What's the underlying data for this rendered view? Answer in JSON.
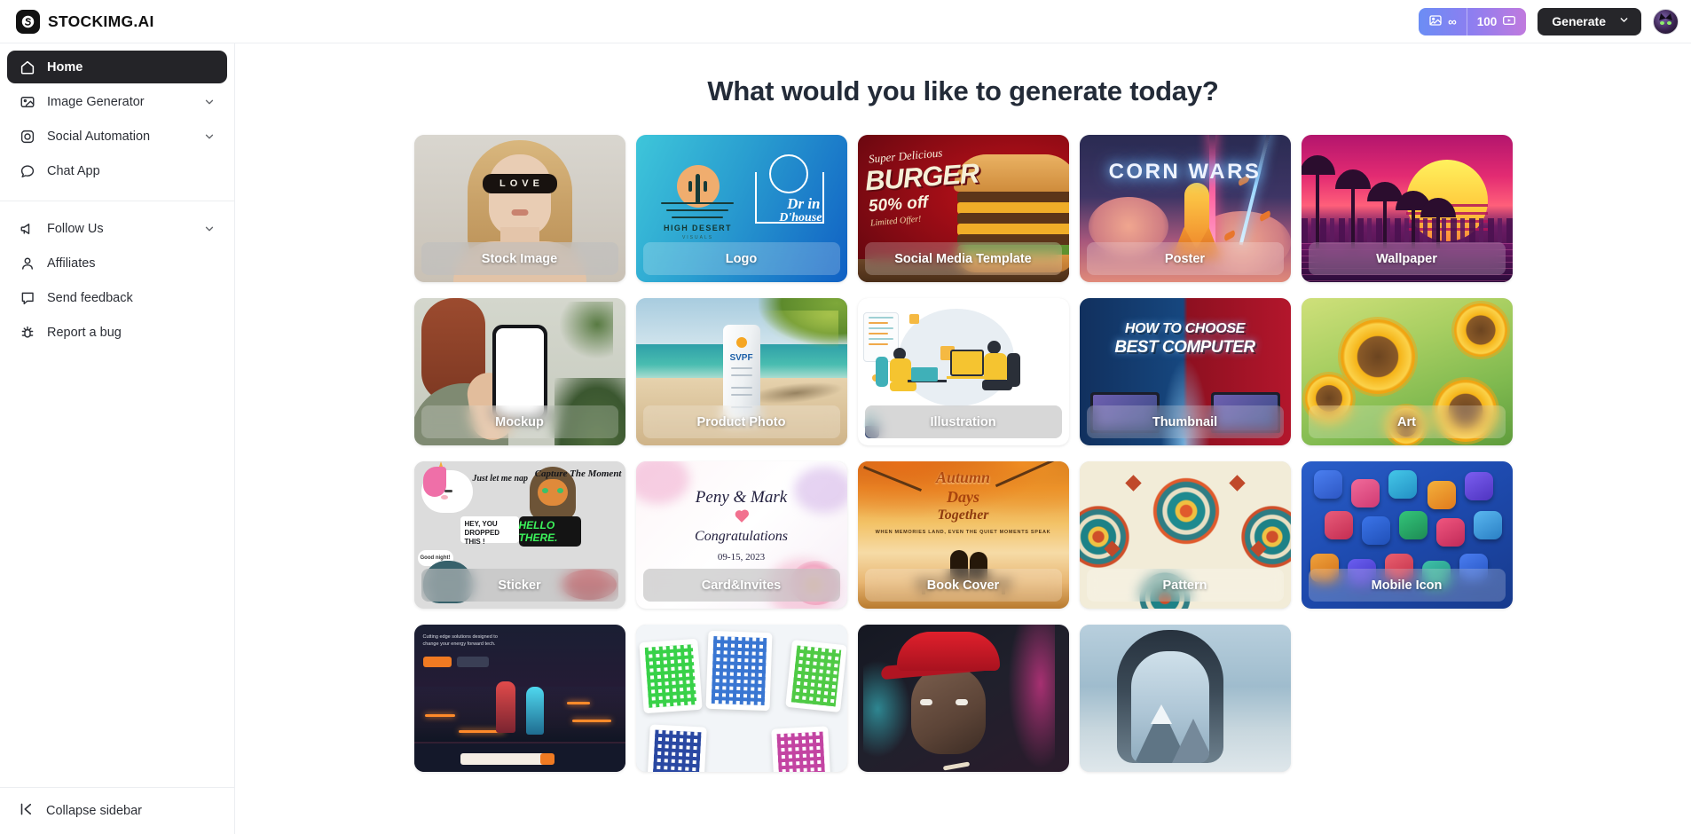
{
  "header": {
    "brand_name": "STOCKIMG.AI",
    "brand_icon": "stockimg-logo-icon",
    "credits": {
      "image_icon": "image-icon",
      "image_count": "∞",
      "video_count": "100",
      "video_icon": "video-play-icon"
    },
    "generate_button": {
      "label": "Generate",
      "chevron_icon": "chevron-down-icon"
    },
    "avatar": "user-avatar"
  },
  "sidebar": {
    "items": [
      {
        "label": "Home",
        "icon": "home-icon",
        "active": true,
        "expandable": false
      },
      {
        "label": "Image Generator",
        "icon": "image-icon",
        "active": false,
        "expandable": true
      },
      {
        "label": "Social Automation",
        "icon": "instagram-icon",
        "active": false,
        "expandable": true
      },
      {
        "label": "Chat App",
        "icon": "chat-bubble-icon",
        "active": false,
        "expandable": false
      }
    ],
    "secondary_items": [
      {
        "label": "Follow Us",
        "icon": "megaphone-icon",
        "expandable": true
      },
      {
        "label": "Affiliates",
        "icon": "person-icon",
        "expandable": false
      },
      {
        "label": "Send feedback",
        "icon": "message-square-icon",
        "expandable": false
      },
      {
        "label": "Report a bug",
        "icon": "bug-icon",
        "expandable": false
      }
    ],
    "collapse": {
      "label": "Collapse sidebar",
      "icon": "collapse-left-icon"
    }
  },
  "main": {
    "title": "What would you like to generate today?",
    "cards": [
      {
        "label": "Stock Image",
        "art": "a-stock",
        "lightbar": true
      },
      {
        "label": "Logo",
        "art": "a-logo",
        "lightbar": false
      },
      {
        "label": "Social Media Template",
        "art": "a-smt",
        "lightbar": false
      },
      {
        "label": "Poster",
        "art": "a-poster",
        "lightbar": false
      },
      {
        "label": "Wallpaper",
        "art": "a-wall",
        "lightbar": false
      },
      {
        "label": "Mockup",
        "art": "a-mock",
        "lightbar": false
      },
      {
        "label": "Product Photo",
        "art": "a-prod",
        "lightbar": false
      },
      {
        "label": "Illustration",
        "art": "a-illu",
        "lightbar": true
      },
      {
        "label": "Thumbnail",
        "art": "a-thumb",
        "lightbar": false
      },
      {
        "label": "Art",
        "art": "a-art",
        "lightbar": false
      },
      {
        "label": "Sticker",
        "art": "a-stick",
        "lightbar": true
      },
      {
        "label": "Card&Invites",
        "art": "a-card",
        "lightbar": true
      },
      {
        "label": "Book Cover",
        "art": "a-book",
        "lightbar": false
      },
      {
        "label": "Pattern",
        "art": "a-patt",
        "lightbar": false
      },
      {
        "label": "Mobile Icon",
        "art": "a-icon",
        "lightbar": false
      },
      {
        "label": "",
        "art": "a-web",
        "lightbar": false
      },
      {
        "label": "",
        "art": "a-qr",
        "lightbar": false
      },
      {
        "label": "",
        "art": "a-port",
        "lightbar": false
      },
      {
        "label": "",
        "art": "a-mtn",
        "lightbar": false
      }
    ],
    "card_art_text": {
      "stock_glasses": "LOVE",
      "logo_name": "HIGH DESERT",
      "logo_sub": "VISUALS",
      "logo_dr1": "Dr in",
      "logo_dr2": "D'house",
      "smt_line1": "Super Delicious",
      "smt_line2": "BURGER",
      "smt_line3": "50% off",
      "smt_line4": "Limited Offer!",
      "poster_title": "CORN WARS",
      "thumb_line1": "HOW TO CHOOSE",
      "thumb_line2": "BEST COMPUTER",
      "sticker_nap": "Just let me nap",
      "sticker_capture": "Capture The Moment",
      "sticker_hey": "HEY, YOU DROPPED THIS !",
      "sticker_hello": "HELLO THERE.",
      "sticker_goodnight": "Good night!",
      "card_names": "Peny & Mark",
      "card_congrats": "Congratulations",
      "card_date": "09-15, 2023",
      "book_line1": "Autumn",
      "book_line2": "Days",
      "book_line3": "Together",
      "book_sub": "WHEN MEMORIES LAND, EVEN THE QUIET MOMENTS SPEAK",
      "product_brand": "SVPF",
      "web_headline": "Cutting edge solutions designed to change your energy forward tech."
    },
    "colors": {
      "accent_dark": "#242428",
      "credits_gradient_start": "#6b8df5",
      "credits_gradient_end": "#c07ade",
      "title": "#232b38"
    }
  }
}
